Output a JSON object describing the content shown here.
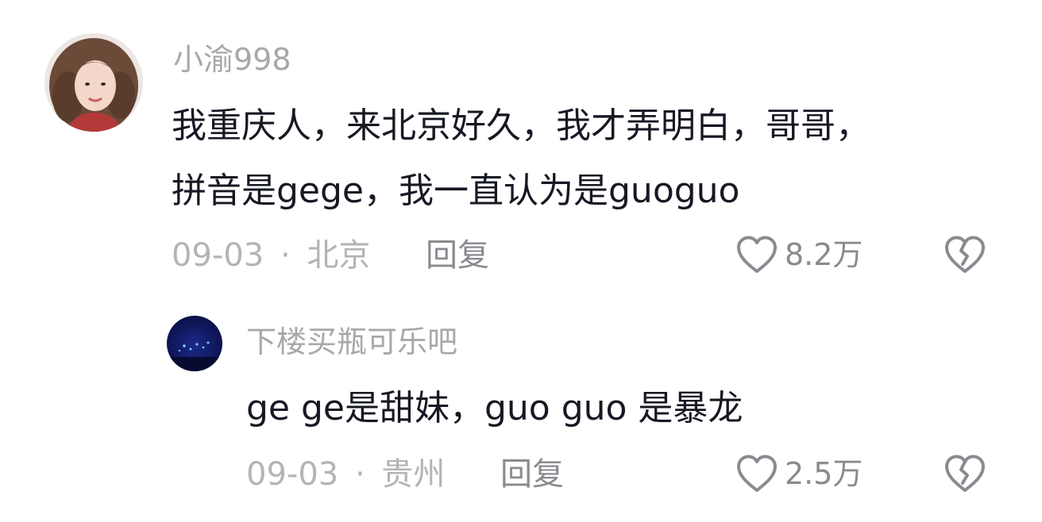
{
  "comments": [
    {
      "username": "小渝998",
      "lines": [
        "我重庆人，来北京好久，我才弄明白，哥哥，",
        "拼音是gege，我一直认为是guoguo"
      ],
      "date": "09-03",
      "separator": "·",
      "location": "北京",
      "reply_label": "回复",
      "likes": "8.2万",
      "avatar_icon": "user-photo-avatar",
      "like_icon": "heart-outline-icon",
      "dislike_icon": "broken-heart-icon"
    },
    {
      "username": "下楼买瓶可乐吧",
      "lines": [
        "ge ge是甜妹，guo guo 是暴龙"
      ],
      "date": "09-03",
      "separator": "·",
      "location": "贵州",
      "reply_label": "回复",
      "likes": "2.5万",
      "avatar_icon": "night-scene-avatar",
      "like_icon": "heart-outline-icon",
      "dislike_icon": "broken-heart-icon"
    }
  ],
  "colors": {
    "text": "#161823",
    "secondary": "#a7a8ab",
    "icon": "#8a8b90"
  }
}
